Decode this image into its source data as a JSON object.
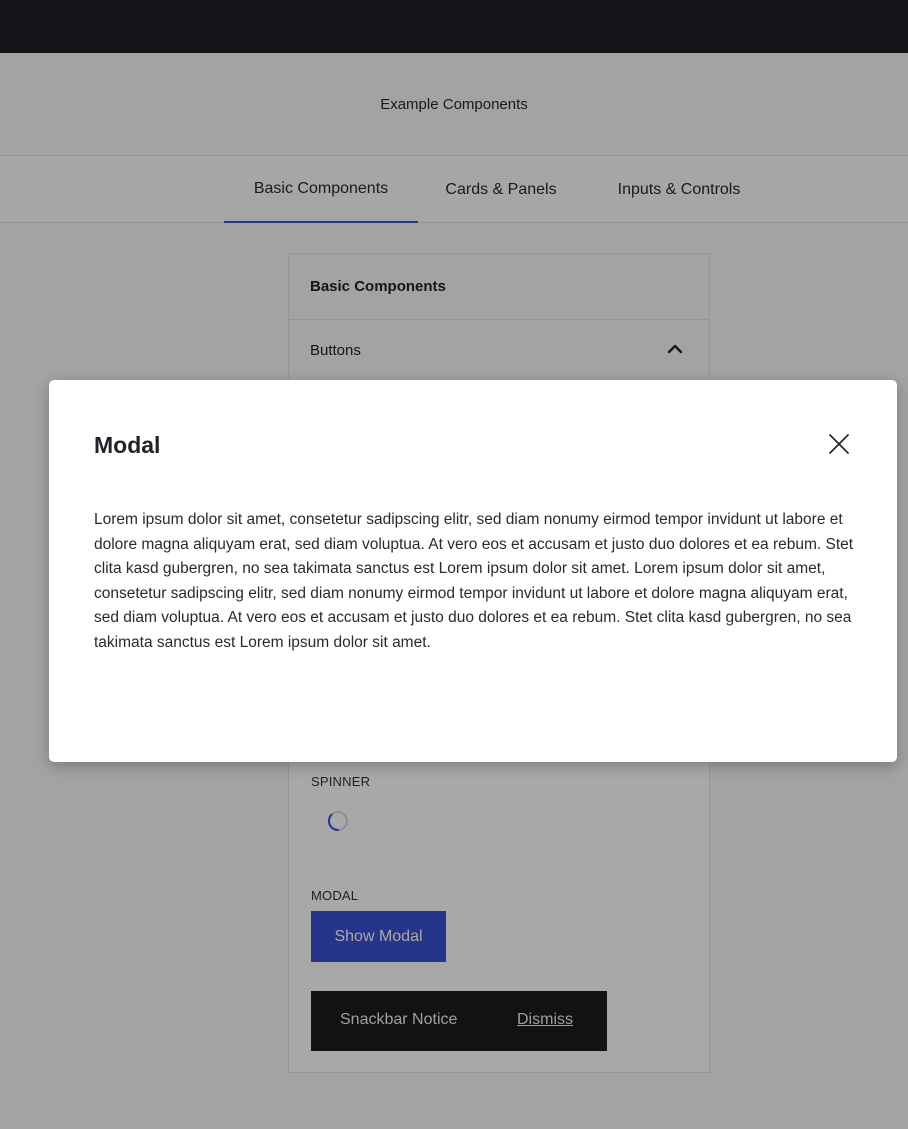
{
  "header": {
    "title": "Example Components"
  },
  "tabs": [
    {
      "label": "Basic Components",
      "active": true
    },
    {
      "label": "Cards & Panels",
      "active": false
    },
    {
      "label": "Inputs & Controls",
      "active": false
    }
  ],
  "panel": {
    "title": "Basic Components",
    "accordion": {
      "label": "Buttons",
      "icon": "chevron-up-icon",
      "expanded": true
    },
    "spinner_label": "SPINNER",
    "modal_label": "MODAL",
    "show_modal_button": "Show Modal",
    "snackbar": {
      "text": "Snackbar Notice",
      "action": "Dismiss"
    }
  },
  "modal": {
    "title": "Modal",
    "close_icon": "close-icon",
    "body": "Lorem ipsum dolor sit amet, consetetur sadipscing elitr, sed diam nonumy eirmod tempor invidunt ut labore et dolore magna aliquyam erat, sed diam voluptua. At vero eos et accusam et justo duo dolores et ea rebum. Stet clita kasd gubergren, no sea takimata sanctus est Lorem ipsum dolor sit amet. Lorem ipsum dolor sit amet, consetetur sadipscing elitr, sed diam nonumy eirmod tempor invidunt ut labore et dolore magna aliquyam erat, sed diam voluptua. At vero eos et accusam et justo duo dolores et ea rebum. Stet clita kasd gubergren, no sea takimata sanctus est Lorem ipsum dolor sit amet."
  },
  "colors": {
    "accent": "#3b50d1",
    "topbar": "#1d2128",
    "snackbar": "#1c1c1c"
  }
}
